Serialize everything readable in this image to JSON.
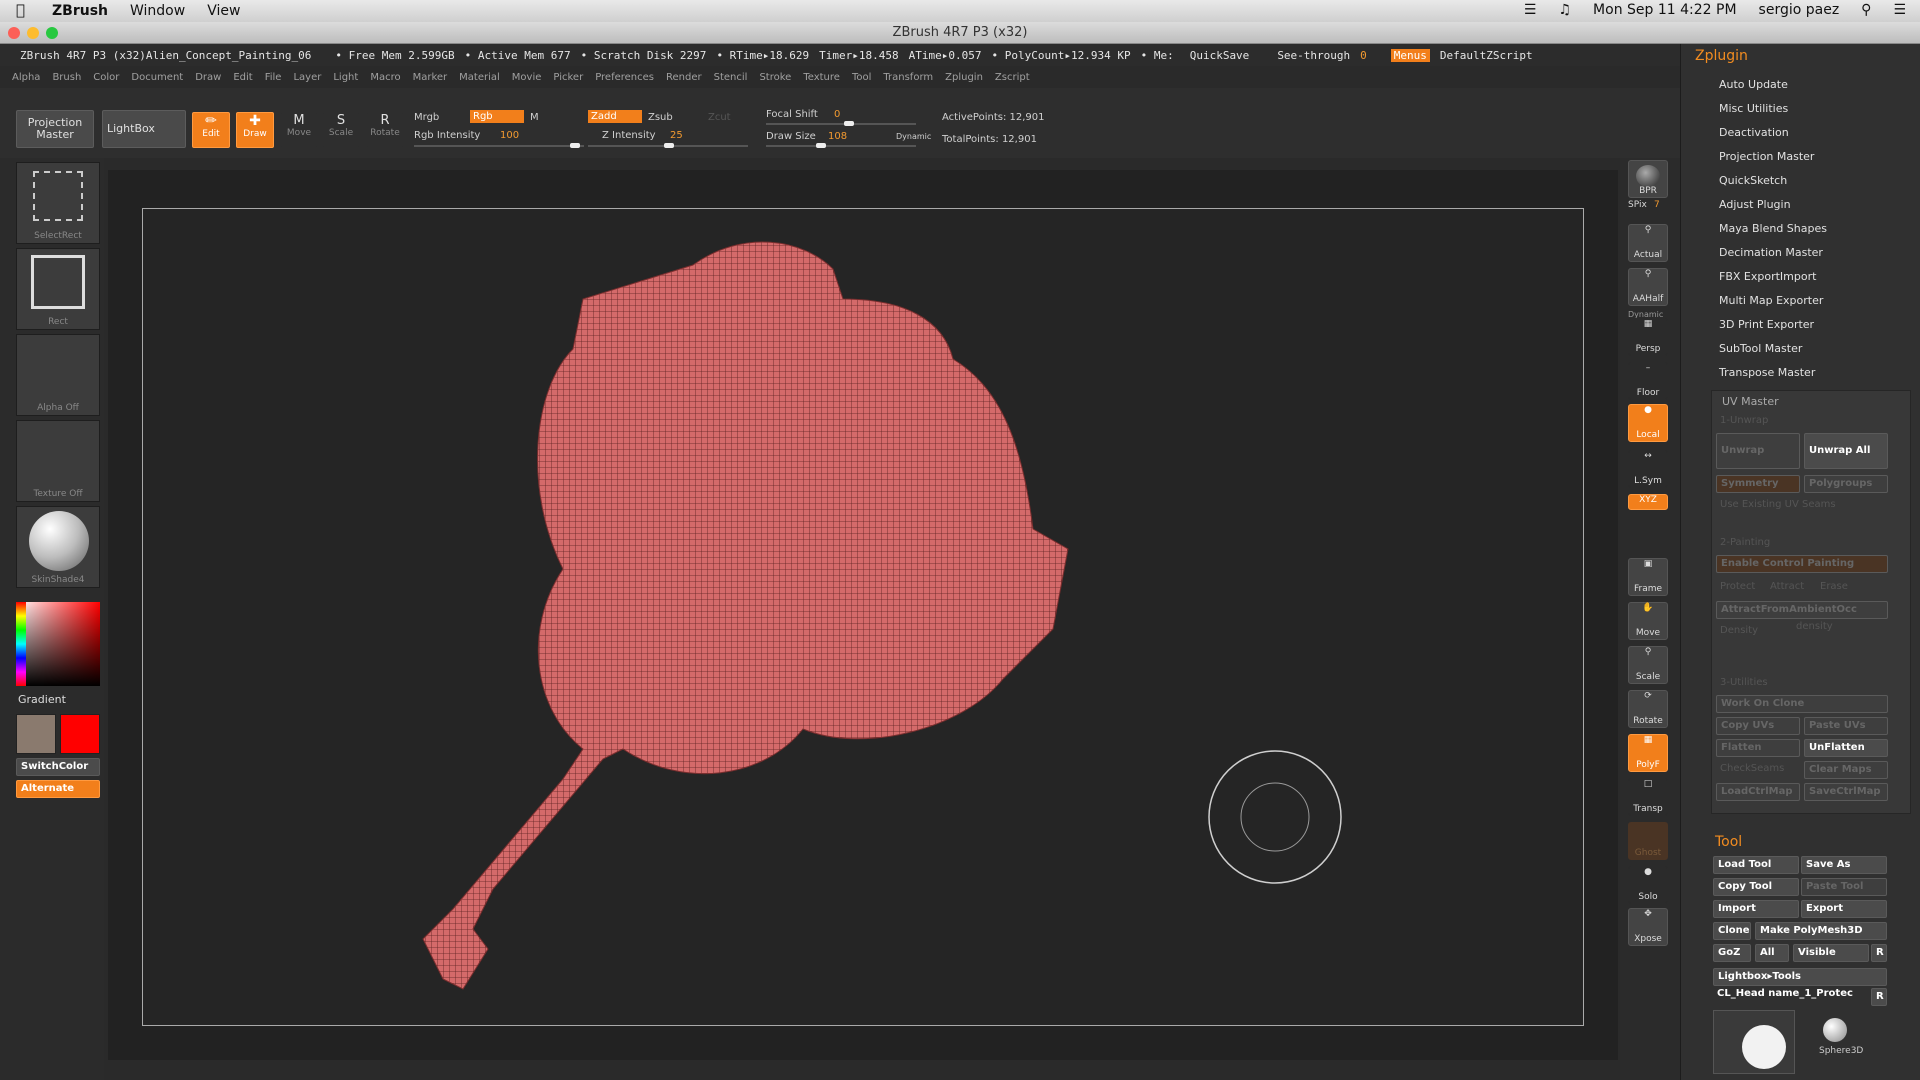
{
  "menubar": {
    "app": "ZBrush",
    "items": [
      "Window",
      "View"
    ],
    "datetime": "Mon Sep 11  4:22 PM",
    "user": "sergio paez"
  },
  "window": {
    "title": "ZBrush 4R7 P3 (x32)"
  },
  "infobar": {
    "doc": "ZBrush 4R7 P3 (x32)Alien_Concept_Painting_06",
    "free_mem": "• Free Mem 2.599GB",
    "active_mem": "• Active Mem 677",
    "scratch": "• Scratch Disk 2297",
    "rtime": "• RTime▸18.629",
    "timer": "Timer▸18.458",
    "atime": "ATime▸0.057",
    "polycount": "• PolyCount▸12.934 KP",
    "me": "• Me:",
    "quicksave": "QuickSave",
    "seethrough": "See-through",
    "seethrough_val": "0",
    "menus": "Menus",
    "script": "DefaultZScript"
  },
  "menus": [
    "Alpha",
    "Brush",
    "Color",
    "Document",
    "Draw",
    "Edit",
    "File",
    "Layer",
    "Light",
    "Macro",
    "Marker",
    "Material",
    "Movie",
    "Picker",
    "Preferences",
    "Render",
    "Stencil",
    "Stroke",
    "Texture",
    "Tool",
    "Transform",
    "Zplugin",
    "Zscript"
  ],
  "toolbar": {
    "projection_master": "Projection Master",
    "lightbox": "LightBox",
    "edit": "Edit",
    "draw": "Draw",
    "move": "Move",
    "scale": "Scale",
    "rotate": "Rotate",
    "mrgb": "Mrgb",
    "rgb": "Rgb",
    "m": "M",
    "zadd": "Zadd",
    "zsub": "Zsub",
    "zcut": "Zcut",
    "rgb_intensity_label": "Rgb Intensity",
    "rgb_intensity": "100",
    "z_intensity_label": "Z Intensity",
    "z_intensity": "25",
    "focal_shift_label": "Focal Shift",
    "focal_shift": "0",
    "draw_size_label": "Draw Size",
    "draw_size": "108",
    "dynamic": "Dynamic",
    "active_points": "ActivePoints: 12,901",
    "total_points": "TotalPoints: 12,901"
  },
  "leftshelf": {
    "selectrect": "SelectRect",
    "rect": "Rect",
    "alpha": "Alpha  Off",
    "texture": "Texture  Off",
    "material": "SkinShade4",
    "gradient": "Gradient",
    "switchcolor": "SwitchColor",
    "alternate": "Alternate",
    "main_color": "#8a7a6e",
    "secondary_color": "#ff0000"
  },
  "rightshelf": {
    "bpr": "BPR",
    "spix": "SPix",
    "spix_val": "7",
    "actual": "Actual",
    "aahalf": "AAHalf",
    "dynamic": "Dynamic",
    "persp": "Persp",
    "floor": "Floor",
    "local": "Local",
    "lsym": "L.Sym",
    "xyz": "XYZ",
    "frame": "Frame",
    "move": "Move",
    "scale": "Scale",
    "rotate": "Rotate",
    "polyf": "PolyF",
    "transp": "Transp",
    "ghost": "Ghost",
    "solo": "Solo",
    "xpose": "Xpose"
  },
  "zplugin": {
    "title": "Zplugin",
    "items": [
      "Auto Update",
      "Misc Utilities",
      "Deactivation",
      "Projection Master",
      "QuickSketch",
      "Adjust Plugin",
      "Maya Blend Shapes",
      "Decimation Master",
      "FBX ExportImport",
      "Multi Map Exporter",
      "3D Print Exporter",
      "SubTool Master",
      "Transpose Master"
    ],
    "uv_master": {
      "title": "UV Master",
      "unwrap_section": "1-Unwrap",
      "unwrap": "Unwrap",
      "unwrap_all": "Unwrap All",
      "symmetry": "Symmetry",
      "polygroups": "Polygroups",
      "use_existing": "Use Existing UV Seams",
      "painting_section": "2-Painting",
      "enable_control": "Enable Control Painting",
      "protect": "Protect",
      "attract": "Attract",
      "erase": "Erase",
      "attract_ambient": "AttractFromAmbientOcc",
      "density": "Density",
      "density_label": "density",
      "utilities_section": "3-Utilities",
      "work_on_clone": "Work On Clone",
      "copy_uvs": "Copy UVs",
      "paste_uvs": "Paste UVs",
      "flatten": "Flatten",
      "unflatten": "UnFlatten",
      "checkseams": "CheckSeams",
      "clear_maps": "Clear Maps",
      "load_ctrl": "LoadCtrlMap",
      "save_ctrl": "SaveCtrlMap"
    }
  },
  "tool": {
    "title": "Tool",
    "load_tool": "Load Tool",
    "save_as": "Save As",
    "copy_tool": "Copy Tool",
    "paste_tool": "Paste Tool",
    "import": "Import",
    "export": "Export",
    "clone": "Clone",
    "make_polymesh": "Make PolyMesh3D",
    "goz": "GoZ",
    "all": "All",
    "visible": "Visible",
    "r": "R",
    "lightbox_tools": "Lightbox▸Tools",
    "current_tool": "CL_Head name_1_Protec",
    "sphere": "Sphere3D"
  }
}
